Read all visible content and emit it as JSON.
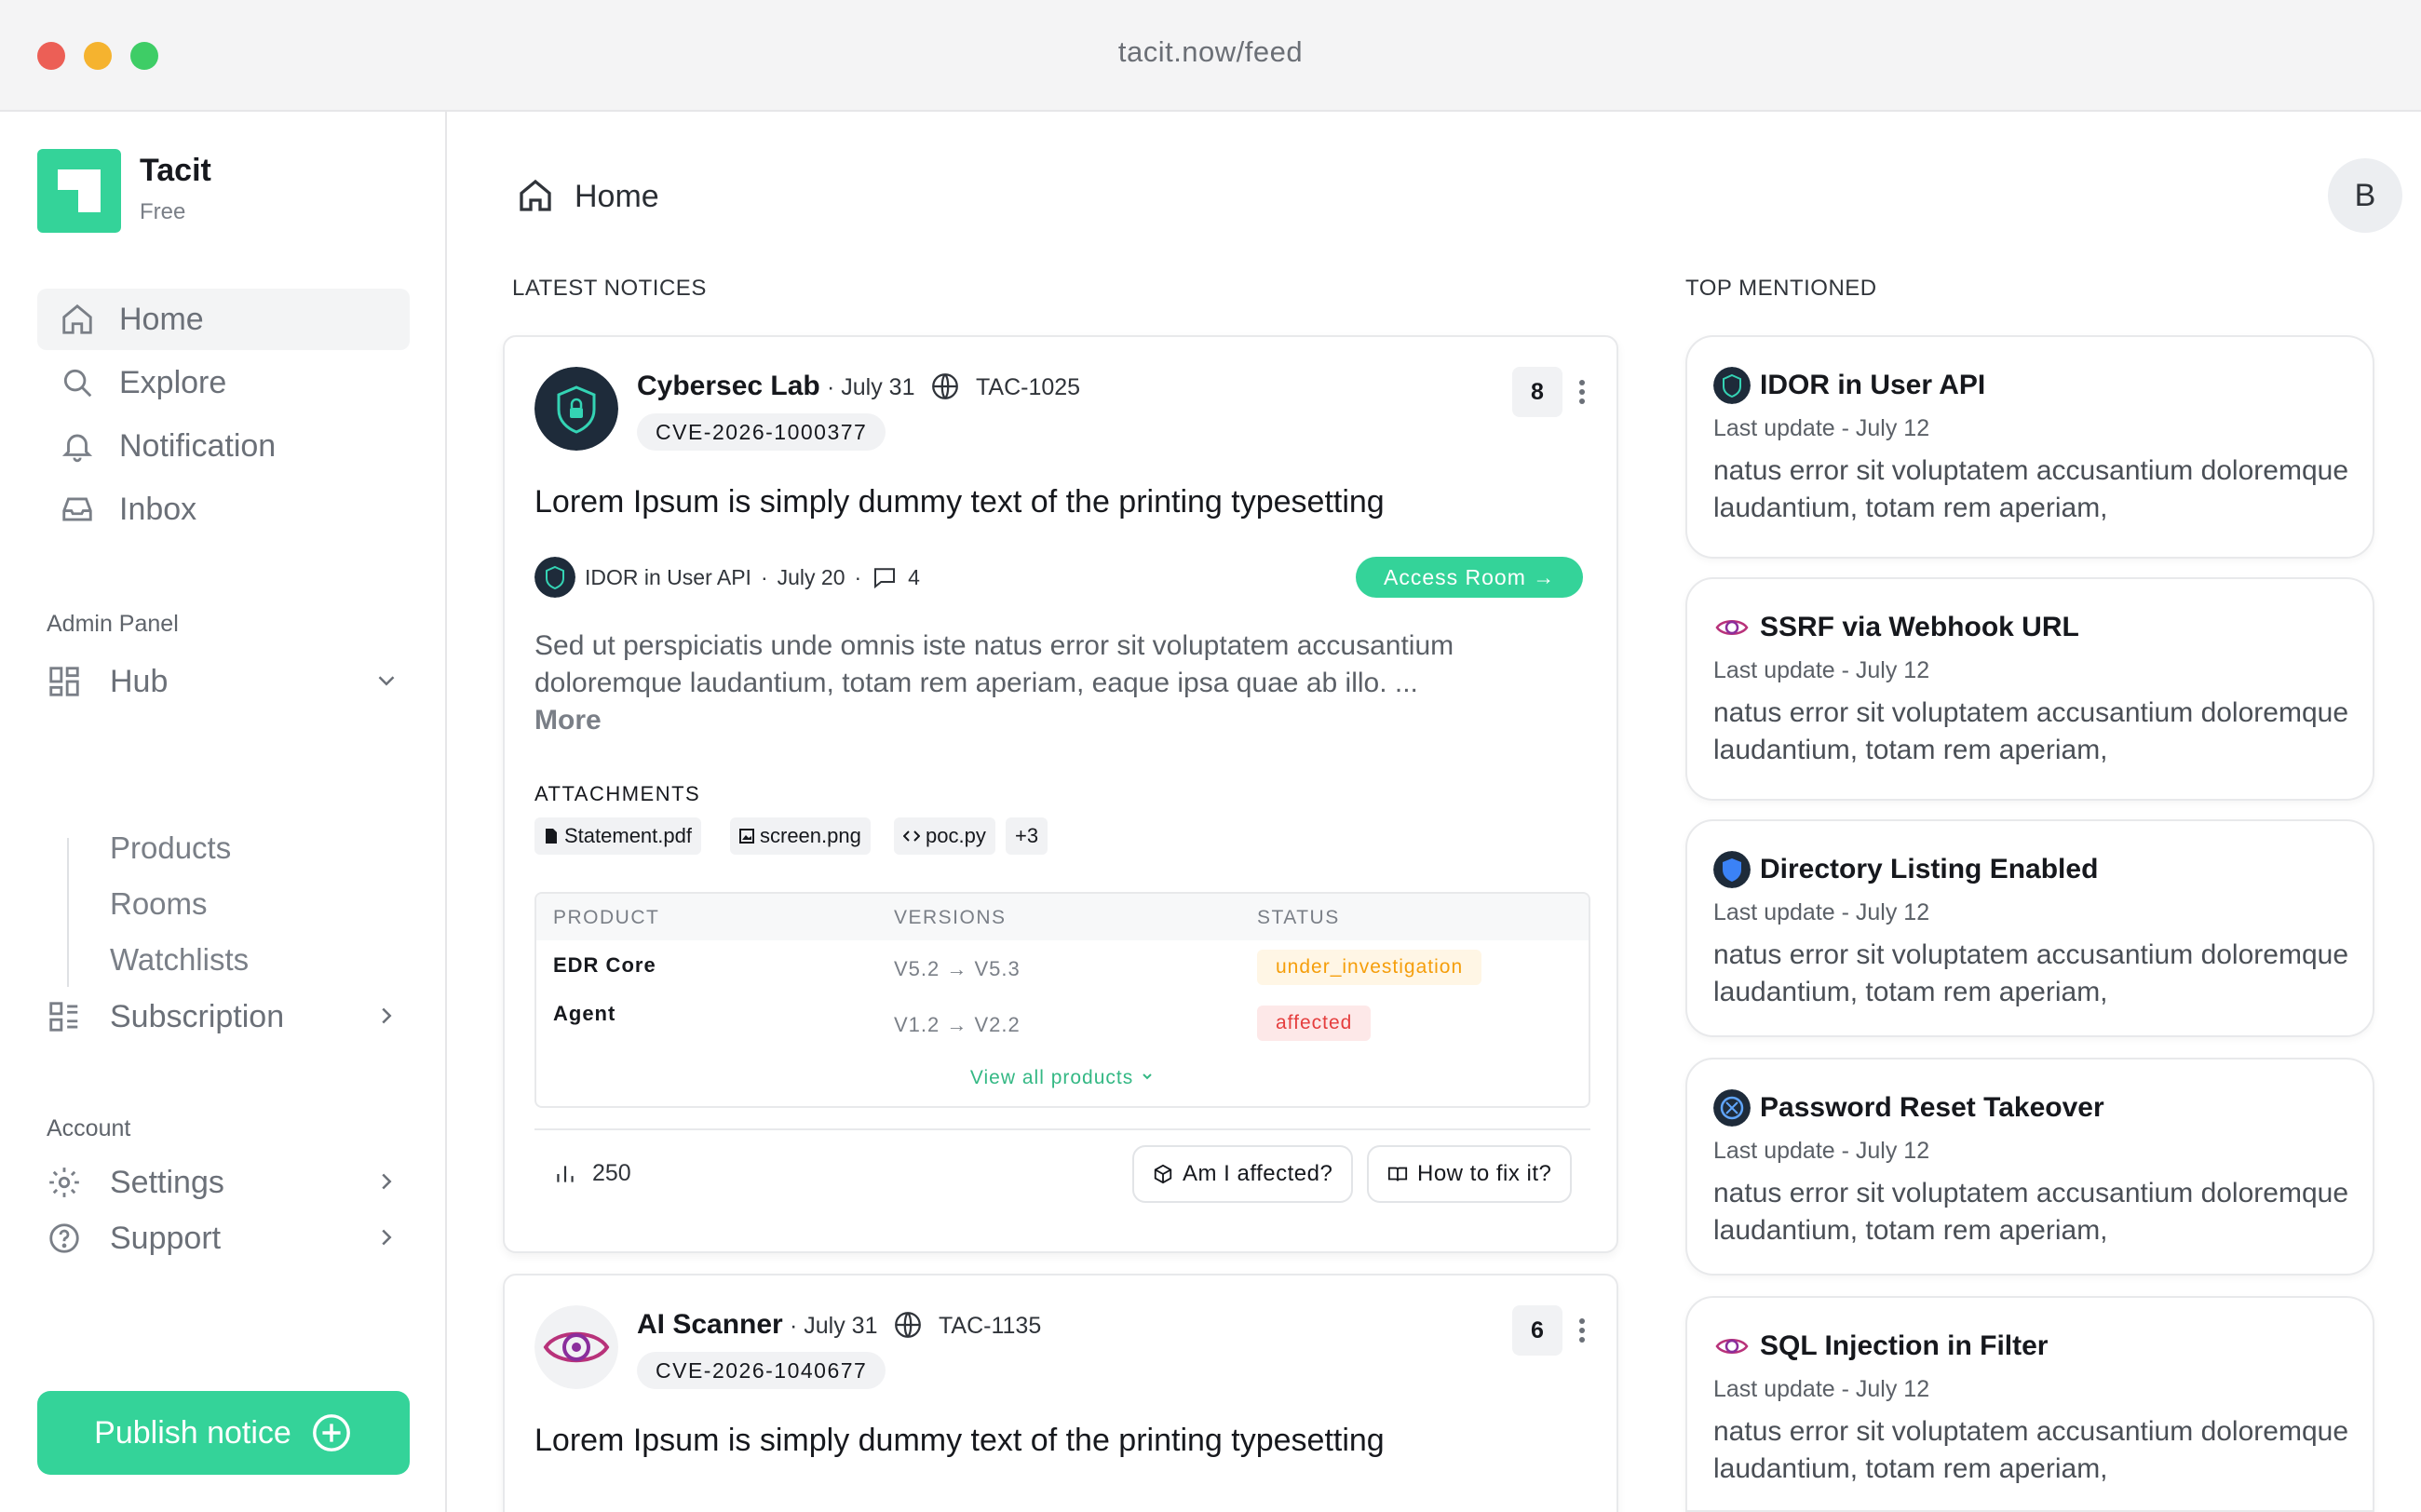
{
  "window": {
    "url": "tacit.now/feed"
  },
  "brand": {
    "name": "Tacit",
    "plan": "Free"
  },
  "nav": [
    {
      "label": "Home",
      "icon": "home-icon",
      "active": true
    },
    {
      "label": "Explore",
      "icon": "search-icon"
    },
    {
      "label": "Notification",
      "icon": "bell-icon"
    },
    {
      "label": "Inbox",
      "icon": "inbox-icon"
    }
  ],
  "admin": {
    "label": "Admin Panel",
    "hub": {
      "label": "Hub",
      "children": [
        "Products",
        "Rooms",
        "Watchlists"
      ]
    },
    "subscription": {
      "label": "Subscription"
    }
  },
  "account": {
    "label": "Account",
    "settings": {
      "label": "Settings"
    },
    "support": {
      "label": "Support"
    }
  },
  "publish": {
    "label": "Publish notice"
  },
  "header": {
    "title": "Home",
    "avatar_initial": "B"
  },
  "sections": {
    "latest": "LATEST NOTICES",
    "top": "TOP MENTIONED"
  },
  "notices": [
    {
      "source": "Cybersec Lab",
      "date": "· July 31",
      "tac": "TAC-1025",
      "cve": "CVE-2026-1000377",
      "count": "8",
      "title": "Lorem Ipsum is simply dummy text of the printing typesetting",
      "room": {
        "name": "IDOR in User API",
        "date": "July 20",
        "comments": "4"
      },
      "access_label": "Access Room →",
      "description": "Sed ut perspiciatis unde omnis iste natus error sit voluptatem accusantium doloremque laudantium, totam rem aperiam, eaque ipsa quae ab illo. ...",
      "more_label": "More",
      "attachments_label": "ATTACHMENTS",
      "attachments": [
        "Statement.pdf",
        "screen.png",
        "poc.py",
        "+3"
      ],
      "table": {
        "headers": [
          "PRODUCT",
          "VERSIONS",
          "STATUS"
        ],
        "rows": [
          {
            "product": "EDR Core",
            "versions": "V5.2 → V5.3",
            "status": "under_investigation"
          },
          {
            "product": "Agent",
            "versions": "V1.2 → V2.2",
            "status": "affected"
          }
        ],
        "view_all": "View all products"
      },
      "views": "250",
      "actions": [
        "Am  I affected?",
        "How to fix it?"
      ]
    },
    {
      "source": "AI Scanner",
      "date": "· July 31",
      "tac": "TAC-1135",
      "cve": "CVE-2026-1040677",
      "count": "6",
      "title": "Lorem Ipsum is simply dummy text of the printing typesetting"
    }
  ],
  "top_mentioned": [
    {
      "title": "IDOR in User API",
      "update": "Last update - July 12",
      "desc": "natus error sit voluptatem accusantium doloremque laudantium, totam rem aperiam,",
      "icon": "shield-lock-icon"
    },
    {
      "title": "SSRF via Webhook URL",
      "update": "Last update - July 12",
      "desc": "natus error sit voluptatem accusantium doloremque laudantium, totam rem aperiam,",
      "icon": "eye-icon"
    },
    {
      "title": "Directory Listing Enabled",
      "update": "Last update - July 12",
      "desc": "natus error sit voluptatem accusantium doloremque laudantium, totam rem aperiam,",
      "icon": "shield-icon"
    },
    {
      "title": "Password Reset Takeover",
      "update": "Last update - July 12",
      "desc": "natus error sit voluptatem accusantium doloremque laudantium, totam rem aperiam,",
      "icon": "bug-icon"
    },
    {
      "title": "SQL Injection in Filter",
      "update": "Last update - July 12",
      "desc": "natus error sit voluptatem accusantium doloremque laudantium, totam rem aperiam,",
      "icon": "eye-icon"
    }
  ],
  "colors": {
    "accent": "#34d399",
    "warning": "#f59e0b",
    "danger": "#e53e3e"
  }
}
